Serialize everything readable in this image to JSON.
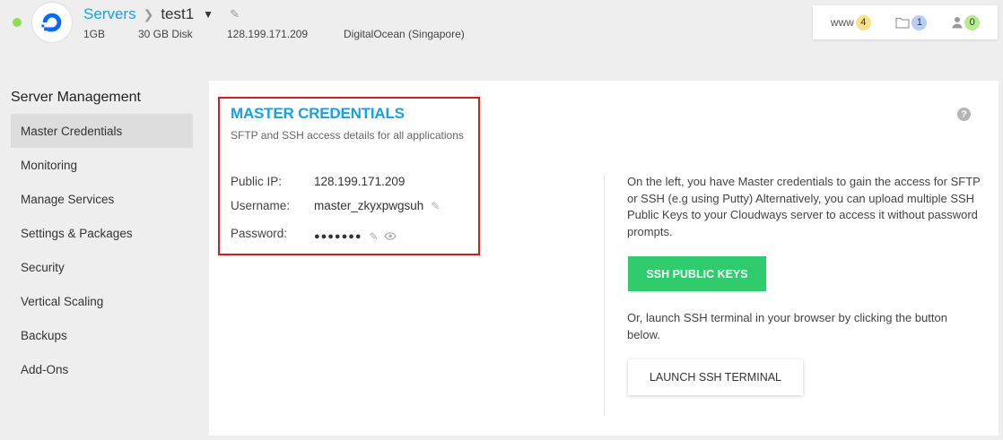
{
  "header": {
    "breadcrumb_root": "Servers",
    "server_name": "test1",
    "specs": {
      "ram": "1GB",
      "disk": "30 GB Disk",
      "ip": "128.199.171.209",
      "provider": "DigitalOcean (Singapore)"
    },
    "counters": [
      {
        "label": "www",
        "count": "4",
        "color": "#fbe08a"
      },
      {
        "label": "",
        "count": "1",
        "color": "#b9cdf7"
      },
      {
        "label": "",
        "count": "0",
        "color": "#b6eb8e"
      }
    ]
  },
  "sidebar": {
    "title": "Server Management",
    "items": [
      {
        "label": "Master Credentials",
        "active": true
      },
      {
        "label": "Monitoring"
      },
      {
        "label": "Manage Services"
      },
      {
        "label": "Settings & Packages"
      },
      {
        "label": "Security"
      },
      {
        "label": "Vertical Scaling"
      },
      {
        "label": "Backups"
      },
      {
        "label": "Add-Ons"
      }
    ]
  },
  "credentials": {
    "title": "MASTER CREDENTIALS",
    "subtitle": "SFTP and SSH access details for all applications",
    "public_ip_label": "Public IP:",
    "public_ip": "128.199.171.209",
    "username_label": "Username:",
    "username": "master_zkyxpwgsuh",
    "password_label": "Password:",
    "password_mask": "●●●●●●●"
  },
  "info": {
    "text": "On the left, you have Master credentials to gain the access for SFTP or SSH (e.g using Putty) Alternatively, you can upload multiple SSH Public Keys to your Cloudways server to access it without password prompts.",
    "ssh_keys_button": "SSH PUBLIC KEYS",
    "terminal_text": "Or, launch SSH terminal in your browser by clicking the button below.",
    "terminal_button": "LAUNCH SSH TERMINAL"
  },
  "icons": {
    "help": "?"
  },
  "colors": {
    "accent": "#1aa0e0",
    "primary_button": "#2fcb6d",
    "highlight": "#d81c1c",
    "status": "#8fdc59"
  }
}
